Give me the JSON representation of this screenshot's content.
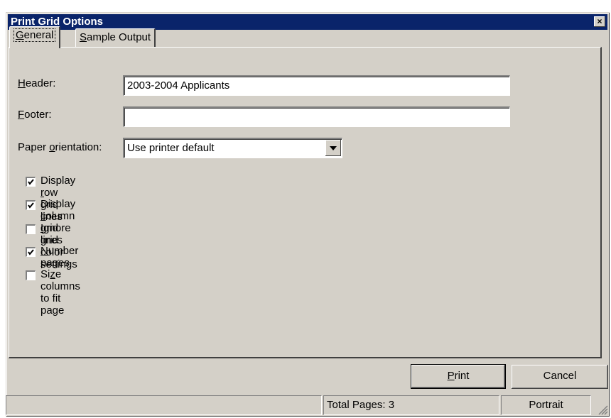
{
  "window": {
    "title": "Print Grid Options",
    "close_glyph": "×"
  },
  "tabs": [
    {
      "label": "General",
      "mnemonic": "G",
      "rest": "eneral",
      "active": true
    },
    {
      "label": "Sample Output",
      "mnemonic": "S",
      "rest": "ample Output",
      "active": false
    }
  ],
  "form": {
    "header": {
      "label_pre": "",
      "label_mn": "H",
      "label_post": "eader:",
      "value": "2003-2004 Applicants"
    },
    "footer": {
      "label_pre": "",
      "label_mn": "F",
      "label_post": "ooter:",
      "value": ""
    },
    "orientation": {
      "label_pre": "Paper ",
      "label_mn": "o",
      "label_post": "rientation:",
      "value": "Use printer default"
    }
  },
  "checkboxes": [
    {
      "pre": "Display ",
      "mn": "r",
      "post": "ow grid lines",
      "checked": true
    },
    {
      "pre": "Display ",
      "mn": "c",
      "post": "olumn grid lines",
      "checked": true
    },
    {
      "pre": "",
      "mn": "I",
      "post": "gnore grid color settings",
      "checked": false
    },
    {
      "pre": "",
      "mn": "N",
      "post": "umber pages",
      "checked": true
    },
    {
      "pre": "Si",
      "mn": "z",
      "post": "e columns to fit page",
      "checked": false
    }
  ],
  "buttons": {
    "print": {
      "mn": "P",
      "post": "rint"
    },
    "cancel": {
      "label": "Cancel"
    }
  },
  "statusbar": {
    "left": "",
    "pages": "Total Pages: 3",
    "orientation": "Portrait"
  },
  "icons": [
    "close-icon",
    "dropdown-arrow-icon",
    "checkmark-icon",
    "size-grip-icon"
  ]
}
